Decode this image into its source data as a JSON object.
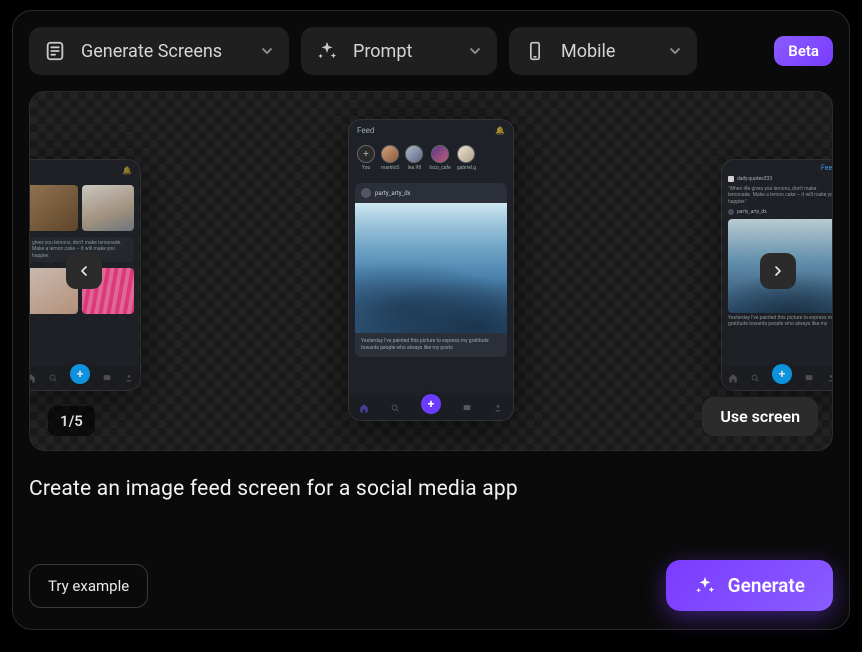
{
  "topbar": {
    "generate_label": "Generate Screens",
    "prompt_label": "Prompt",
    "mobile_label": "Mobile",
    "beta_label": "Beta"
  },
  "canvas": {
    "counter": "1/5",
    "use_screen_label": "Use screen"
  },
  "center_phone": {
    "title": "Feed",
    "stories": [
      {
        "label": "You"
      },
      {
        "label": "markloS"
      },
      {
        "label": "lea.98"
      },
      {
        "label": "loco_cafe"
      },
      {
        "label": "gabriel.g"
      }
    ],
    "post_user": "party_arty_dx",
    "post_caption": "Yesterday I've painted this picture to express my gratitude towards people who always like my posts"
  },
  "left_phone": {
    "caption": "gives you lemons, don't make lemonade. Make a lemon cake – it will make you happier."
  },
  "right_phone": {
    "title": "Feed",
    "quote_user": "daily.quotes333",
    "quote": "\"When life gives you lemons, don't make lemonade. Make a lemon cake – it will make you happier.\"",
    "post_user": "party_arty_dx",
    "post_caption": "Yesterday I've painted this picture to express my gratitude towards people who always like my"
  },
  "prompt_text": "Create an image feed screen for a social media app",
  "actions": {
    "try_label": "Try example",
    "generate_label": "Generate"
  }
}
